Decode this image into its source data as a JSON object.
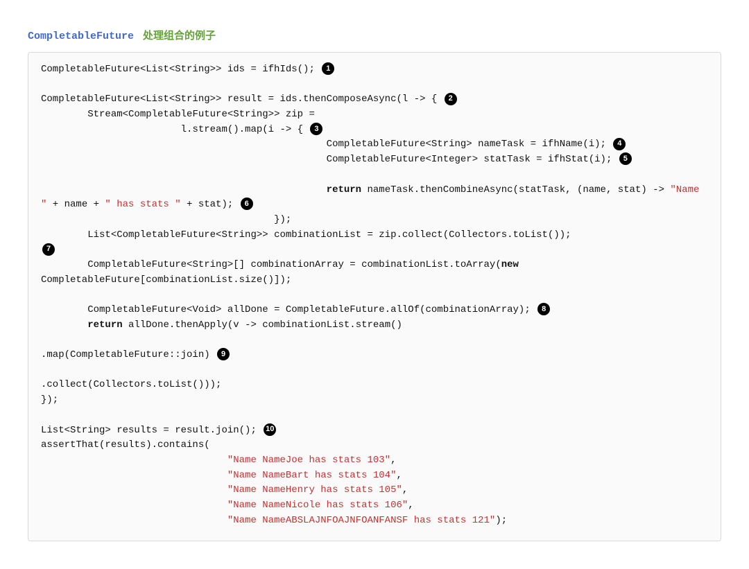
{
  "title": {
    "class": "CompletableFuture",
    "suffix": "处理组合的例子"
  },
  "callouts": {
    "c1": "1",
    "c2": "2",
    "c3": "3",
    "c4": "4",
    "c5": "5",
    "c6": "6",
    "c7": "7",
    "c8": "8",
    "c9": "9",
    "c10": "10"
  },
  "code": {
    "l1": "CompletableFuture<List<String>> ids = ifhIds(); ",
    "l2": "CompletableFuture<List<String>> result = ids.thenComposeAsync(l -> { ",
    "l3": "        Stream<CompletableFuture<String>> zip =",
    "l4": "                        l.stream().map(i -> { ",
    "l5": "                                                 CompletableFuture<String> nameTask = ifhName(i); ",
    "l6": "                                                 CompletableFuture<Integer> statTask = ifhStat(i); ",
    "ret": "return",
    "l7a": " nameTask.thenCombineAsync(statTask, (name, stat) -> ",
    "s_name": "\"Name \"",
    "plus1": " + name + ",
    "s_hasstats": "\" has stats \"",
    "plus2": " + stat); ",
    "l7close": "                                        });",
    "l8": "        List<CompletableFuture<String>> combinationList = zip.collect(Collectors.toList());",
    "l9a": "        CompletableFuture<String>[] combinationArray = combinationList.toArray(",
    "kw_new": "new",
    "l9b": " CompletableFuture[combinationList.size()]);",
    "l10": "        CompletableFuture<Void> allDone = CompletableFuture.allOf(combinationArray); ",
    "l11_spaces": "        ",
    "l11b": " allDone.thenApply(v -> combinationList.stream()",
    "blank": "",
    "l12": ".map(CompletableFuture::join) ",
    "l13": ".collect(Collectors.toList()));",
    "l14": "});",
    "l15": "List<String> results = result.join(); ",
    "l16": "assertThat(results).contains(",
    "pad": "                                ",
    "r1": "\"Name NameJoe has stats 103\"",
    "r2": "\"Name NameBart has stats 104\"",
    "r3": "\"Name NameHenry has stats 105\"",
    "r4": "\"Name NameNicole has stats 106\"",
    "r5": "\"Name NameABSLAJNFOAJNFOANFANSF has stats 121\"",
    "comma": ",",
    "paren": ");"
  }
}
